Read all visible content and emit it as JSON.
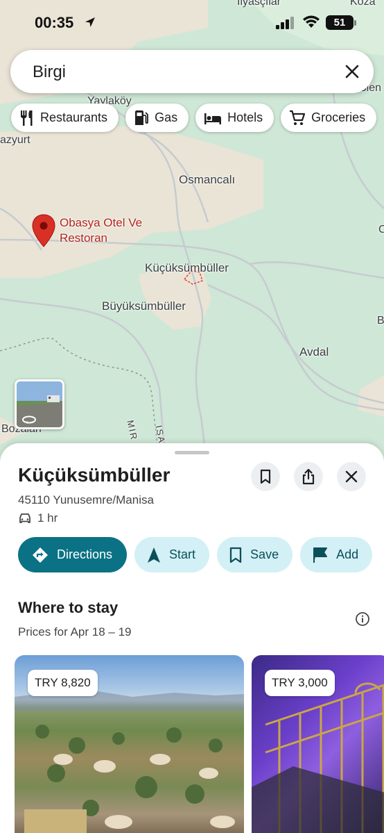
{
  "status_bar": {
    "time": "00:35",
    "battery": "51"
  },
  "search": {
    "query": "Birgi"
  },
  "chips": [
    {
      "label": "Restaurants",
      "icon": "fork-knife-icon"
    },
    {
      "label": "Gas",
      "icon": "gas-pump-icon"
    },
    {
      "label": "Hotels",
      "icon": "bed-icon"
    },
    {
      "label": "Groceries",
      "icon": "cart-icon"
    }
  ],
  "map": {
    "labels": {
      "ilyascilar": "İlyasçılar",
      "yaylakoy": "Yaylaköy",
      "sien": "Sien",
      "azyurt": "azyurt",
      "osmancali": "Osmancalı",
      "kucuksumbuller": "Küçüksümbüller",
      "buyuksumbuller": "Büyüksümbüller",
      "avdal": "Avdal",
      "bozalan": "Bozalan",
      "mir": "MIR",
      "isa": "ISA",
      "b_edge": "B",
      "c_edge": "C",
      "koza": "Koza"
    },
    "poi": {
      "line1": "Obasya Otel Ve",
      "line2": "Restoran",
      "color": "#d93025"
    }
  },
  "place": {
    "name": "Küçüksümbüller",
    "address": "45110 Yunusemre/Manisa",
    "drive_time": "1 hr"
  },
  "actions": {
    "directions": "Directions",
    "start": "Start",
    "save": "Save",
    "add": "Add"
  },
  "stay": {
    "title": "Where to stay",
    "dates": "Prices for Apr 18 – 19",
    "hotels": [
      {
        "price": "TRY 8,820"
      },
      {
        "price": "TRY 3,000"
      }
    ]
  },
  "colors": {
    "accent": "#0b7285",
    "tonal": "#d3f0f6",
    "map_green": "#cfe7d6",
    "map_land": "#e9e4d6"
  }
}
